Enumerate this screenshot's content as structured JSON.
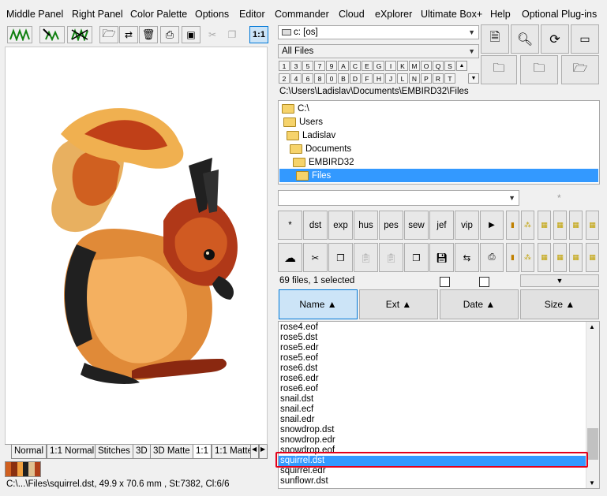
{
  "menu": {
    "items": [
      "Middle Panel",
      "Right Panel",
      "Color Palette",
      "Options",
      "Editor",
      "Commander",
      "Cloud",
      "eXplorer",
      "Ultimate Box+",
      "Help",
      "Optional Plug-ins"
    ]
  },
  "left_toolbar": {
    "zoom_label": "1:1"
  },
  "left_tabs": [
    "Normal",
    "1:1 Normal",
    "Stitches",
    "3D",
    "3D Matte",
    "1:1",
    "1:1 Matte"
  ],
  "left_status": {
    "text": "C:\\...\\Files\\squirrel.dst, 49.9 x 70.6 mm , St:7382, Cl:6/6",
    "swatch_colors": [
      "#d06020",
      "#8a3010",
      "#f0a040",
      "#202020",
      "#e0c090",
      "#b04018"
    ]
  },
  "drive_combo": {
    "value": "c: [os]"
  },
  "filter_combo": {
    "value": "All Files"
  },
  "letter_rows": {
    "row1": [
      "1",
      "3",
      "5",
      "7",
      "9",
      "A",
      "C",
      "E",
      "G",
      "I",
      "K",
      "M",
      "O",
      "Q",
      "S"
    ],
    "row2": [
      "2",
      "4",
      "6",
      "8",
      "0",
      "B",
      "D",
      "F",
      "H",
      "J",
      "L",
      "N",
      "P",
      "R",
      "T"
    ]
  },
  "path": "C:\\Users\\Ladislav\\Documents\\EMBIRD32\\Files",
  "tree": {
    "items": [
      "C:\\",
      "Users",
      "Ladislav",
      "Documents",
      "EMBIRD32",
      "Files"
    ]
  },
  "format_buttons": {
    "row1": [
      "*",
      "dst",
      "exp",
      "hus",
      "pes",
      "sew",
      "jef",
      "vip"
    ],
    "star_label": "*"
  },
  "files_info": "69 files, 1 selected",
  "columns": {
    "name": "Name ▲",
    "ext": "Ext ▲",
    "date": "Date ▲",
    "size": "Size ▲"
  },
  "files": [
    "rose4.eof",
    "rose5.dst",
    "rose5.edr",
    "rose5.eof",
    "rose6.dst",
    "rose6.edr",
    "rose6.eof",
    "snail.dst",
    "snail.ecf",
    "snail.edr",
    "snowdrop.dst",
    "snowdrop.edr",
    "snowdrop.eof",
    "squirrel.dst",
    "squirrel.edr",
    "sunflowr.dst"
  ],
  "selected_file": "squirrel.dst",
  "colors": {
    "selection": "#3399ff",
    "highlight_outline": "#e3001b",
    "active_header": "#cce4f7"
  }
}
